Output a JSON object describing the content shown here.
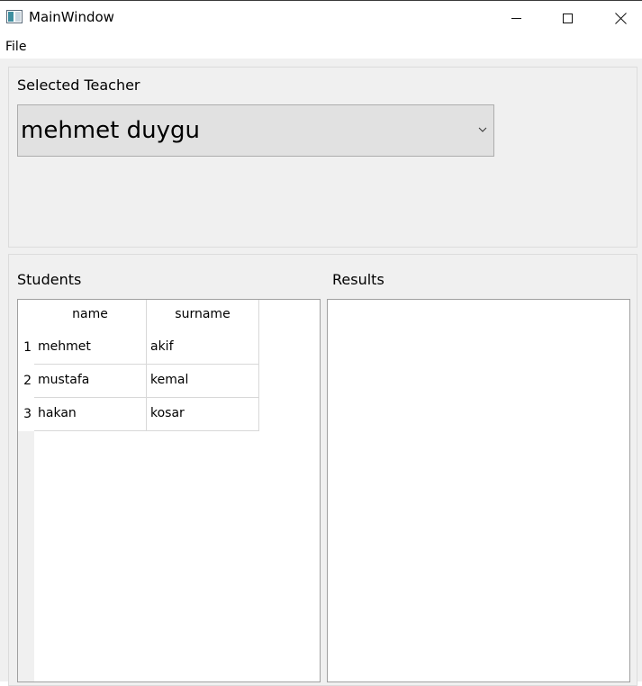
{
  "window": {
    "title": "MainWindow",
    "icons": {
      "app": "window-app-icon",
      "minimize": "minimize-icon",
      "maximize": "maximize-icon",
      "close": "close-icon"
    }
  },
  "menu": {
    "file": "File"
  },
  "teacher": {
    "label": "Selected Teacher",
    "selected": "mehmet duygu",
    "dropdown_icon": "chevron-down-icon"
  },
  "students": {
    "label": "Students",
    "columns": [
      "name",
      "surname"
    ],
    "rows": [
      {
        "index": "1",
        "name": "mehmet",
        "surname": "akif"
      },
      {
        "index": "2",
        "name": "mustafa",
        "surname": "kemal"
      },
      {
        "index": "3",
        "name": "hakan",
        "surname": "kosar"
      }
    ]
  },
  "results": {
    "label": "Results"
  }
}
